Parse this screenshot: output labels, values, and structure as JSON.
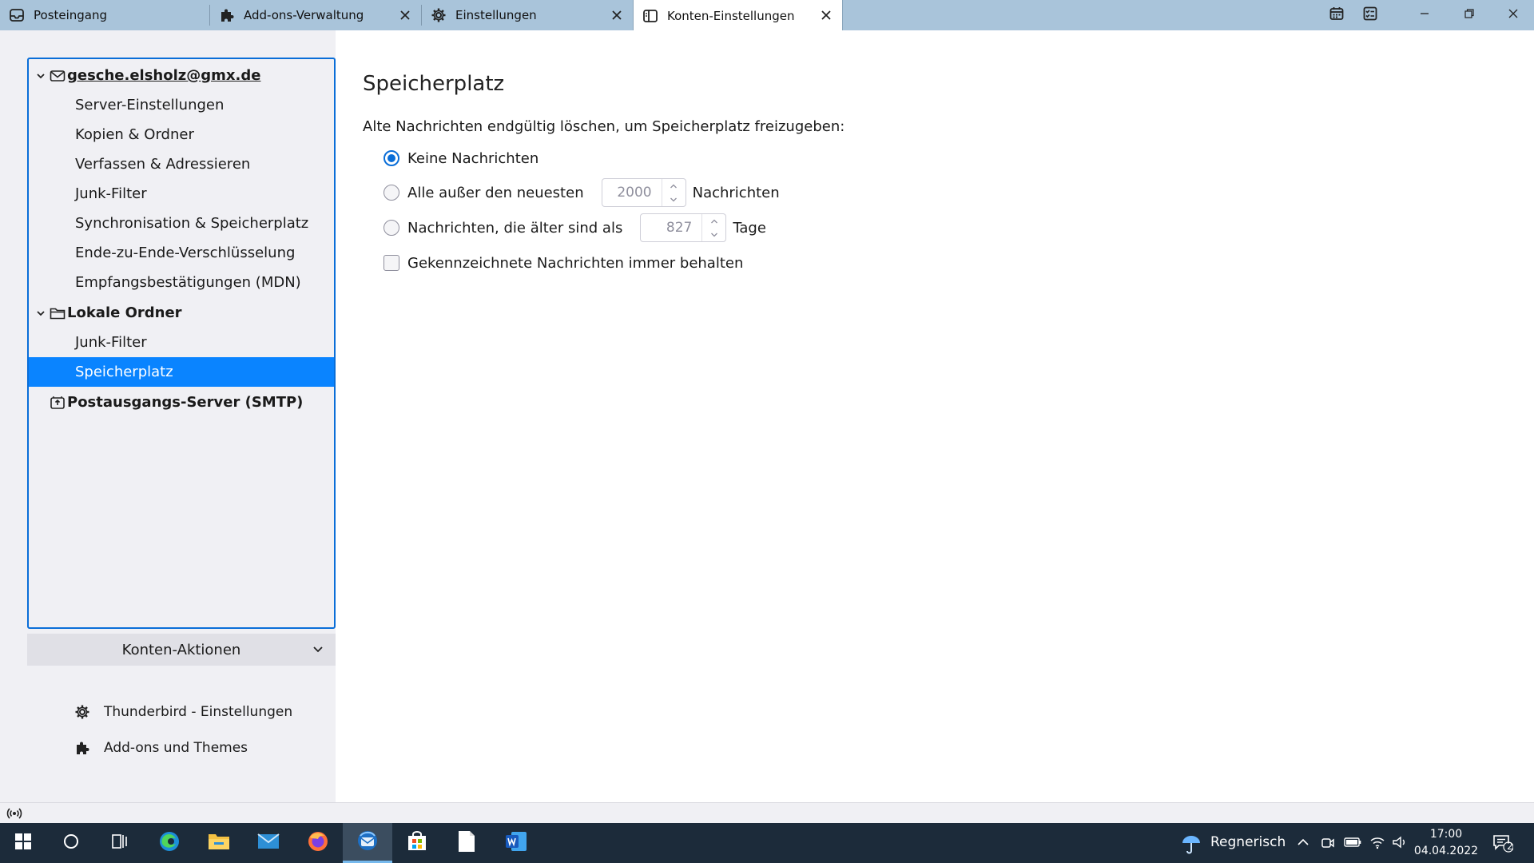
{
  "tabs": [
    {
      "label": "Posteingang",
      "icon": "inbox-icon"
    },
    {
      "label": "Add-ons-Verwaltung",
      "icon": "puzzle-icon"
    },
    {
      "label": "Einstellungen",
      "icon": "gear-icon"
    },
    {
      "label": "Konten-Einstellungen",
      "icon": "account-settings-icon",
      "active": true
    }
  ],
  "tree": {
    "account1": {
      "label": "gesche.elsholz@gmx.de",
      "children": [
        "Server-Einstellungen",
        "Kopien & Ordner",
        "Verfassen & Adressieren",
        "Junk-Filter",
        "Synchronisation & Speicherplatz",
        "Ende-zu-Ende-Verschlüsselung",
        "Empfangsbestätigungen (MDN)"
      ]
    },
    "local": {
      "label": "Lokale Ordner",
      "children": [
        "Junk-Filter",
        "Speicherplatz"
      ]
    },
    "smtp": {
      "label": "Postausgangs-Server (SMTP)"
    }
  },
  "sidebar": {
    "actions_label": "Konten-Aktionen",
    "settings_link": "Thunderbird - Einstellungen",
    "addons_link": "Add-ons und Themes"
  },
  "content": {
    "title": "Speicherplatz",
    "intro": "Alte Nachrichten endgültig löschen, um Speicherplatz freizugeben:",
    "opt_none": "Keine Nachrichten",
    "opt_keep_newest_pre": "Alle außer den neuesten",
    "opt_keep_newest_value": "2000",
    "opt_keep_newest_post": "Nachrichten",
    "opt_older_pre": "Nachrichten, die älter sind als",
    "opt_older_value": "827",
    "opt_older_post": "Tage",
    "opt_keep_flagged": "Gekennzeichnete Nachrichten immer behalten"
  },
  "taskbar": {
    "weather": "Regnerisch",
    "time": "17:00",
    "date": "04.04.2022",
    "notifications": "2"
  },
  "colors": {
    "accent": "#0a84ff",
    "tabbar": "#a9c4da",
    "taskbar": "#1c2b3a"
  }
}
